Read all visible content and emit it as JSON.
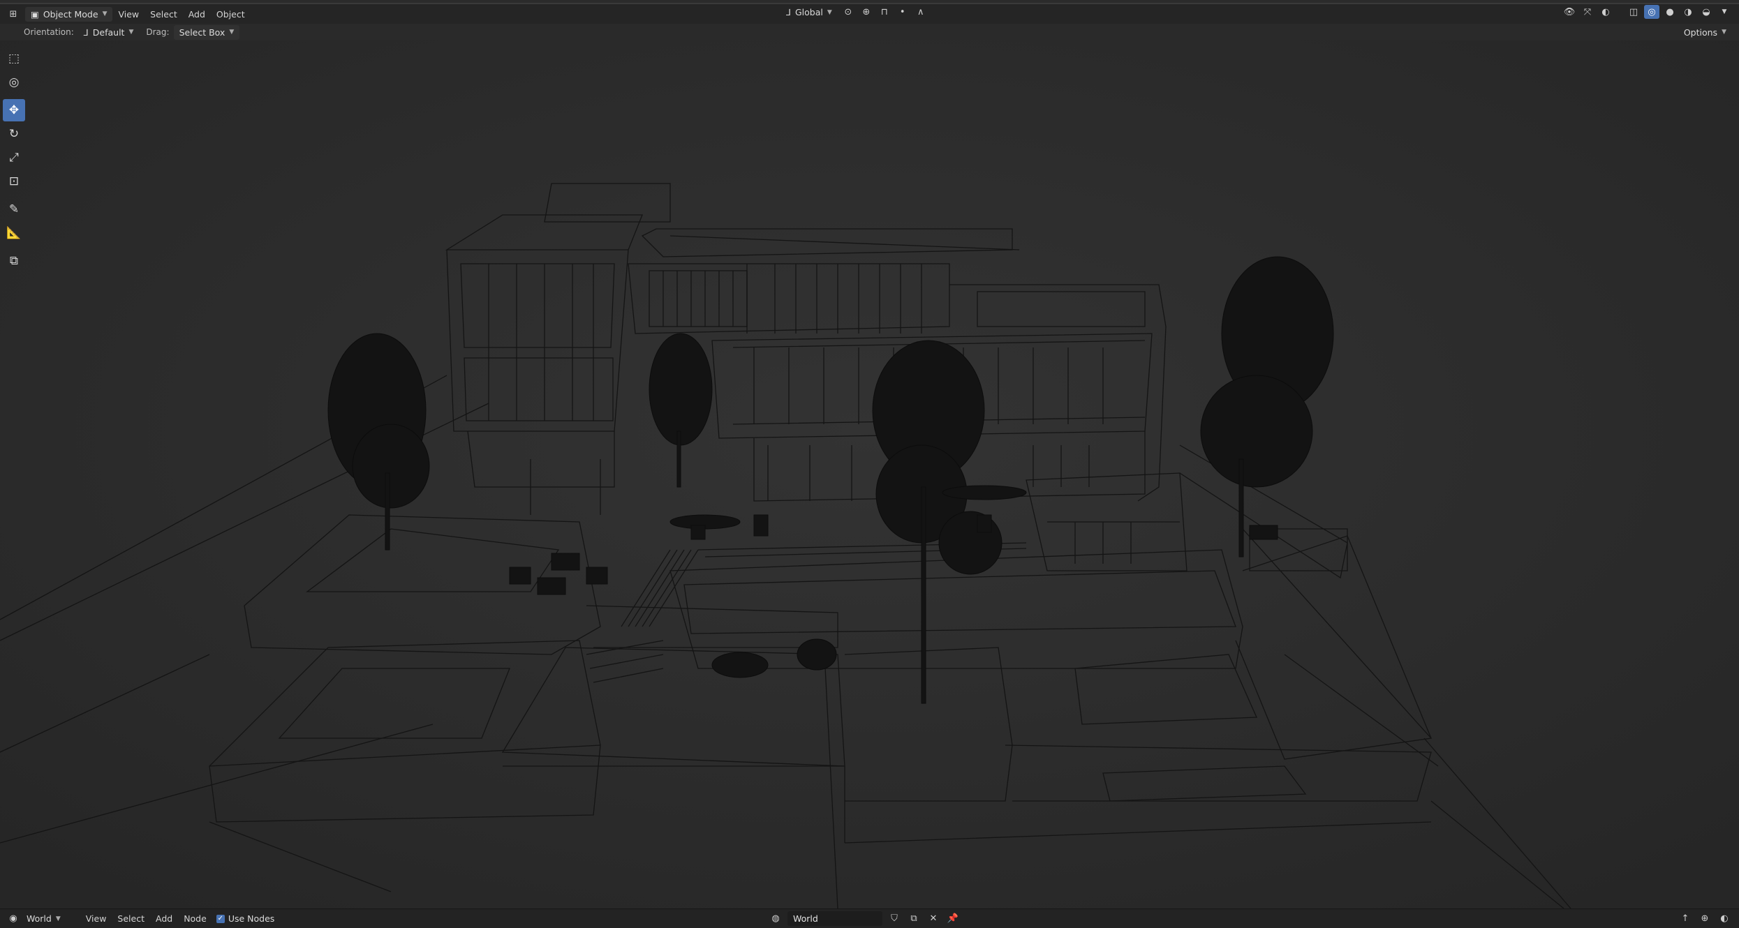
{
  "header": {
    "mode": "Object Mode",
    "menus": [
      "View",
      "Select",
      "Add",
      "Object"
    ],
    "transform_orientation": "Global"
  },
  "tool_options": {
    "orientation_label": "Orientation:",
    "orientation_value": "Default",
    "drag_label": "Drag:",
    "drag_value": "Select Box",
    "options_label": "Options"
  },
  "toolbar": {
    "tools": [
      "select-box-icon",
      "cursor-icon",
      "move-icon",
      "rotate-icon",
      "scale-icon",
      "transform-icon",
      "annotate-icon",
      "measure-icon",
      "add-cube-icon"
    ],
    "active": "move-icon"
  },
  "bottom": {
    "editor": "World",
    "menus": [
      "View",
      "Select",
      "Add",
      "Node"
    ],
    "use_nodes_label": "Use Nodes",
    "use_nodes_checked": true,
    "world_name": "World"
  },
  "colors": {
    "accent": "#4772b3",
    "background": "#2b2b2b",
    "wire": "#111111"
  }
}
